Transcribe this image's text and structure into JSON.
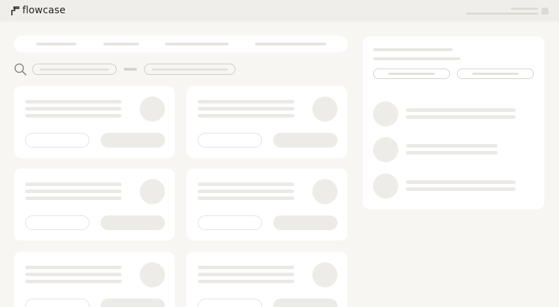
{
  "app": {
    "brand_name": "flowcase",
    "logo_icon": "flowcase-logo-icon"
  },
  "topbar": {
    "user_menu_icon": "user-menu-icon"
  },
  "filters": {
    "search_icon": "search-icon"
  },
  "colors": {
    "background": "#f7f6f3",
    "topbar": "#efeeea",
    "card": "#ffffff",
    "skeleton": "#ebe9e5",
    "outline": "#cfcdc8",
    "text": "#222222"
  }
}
